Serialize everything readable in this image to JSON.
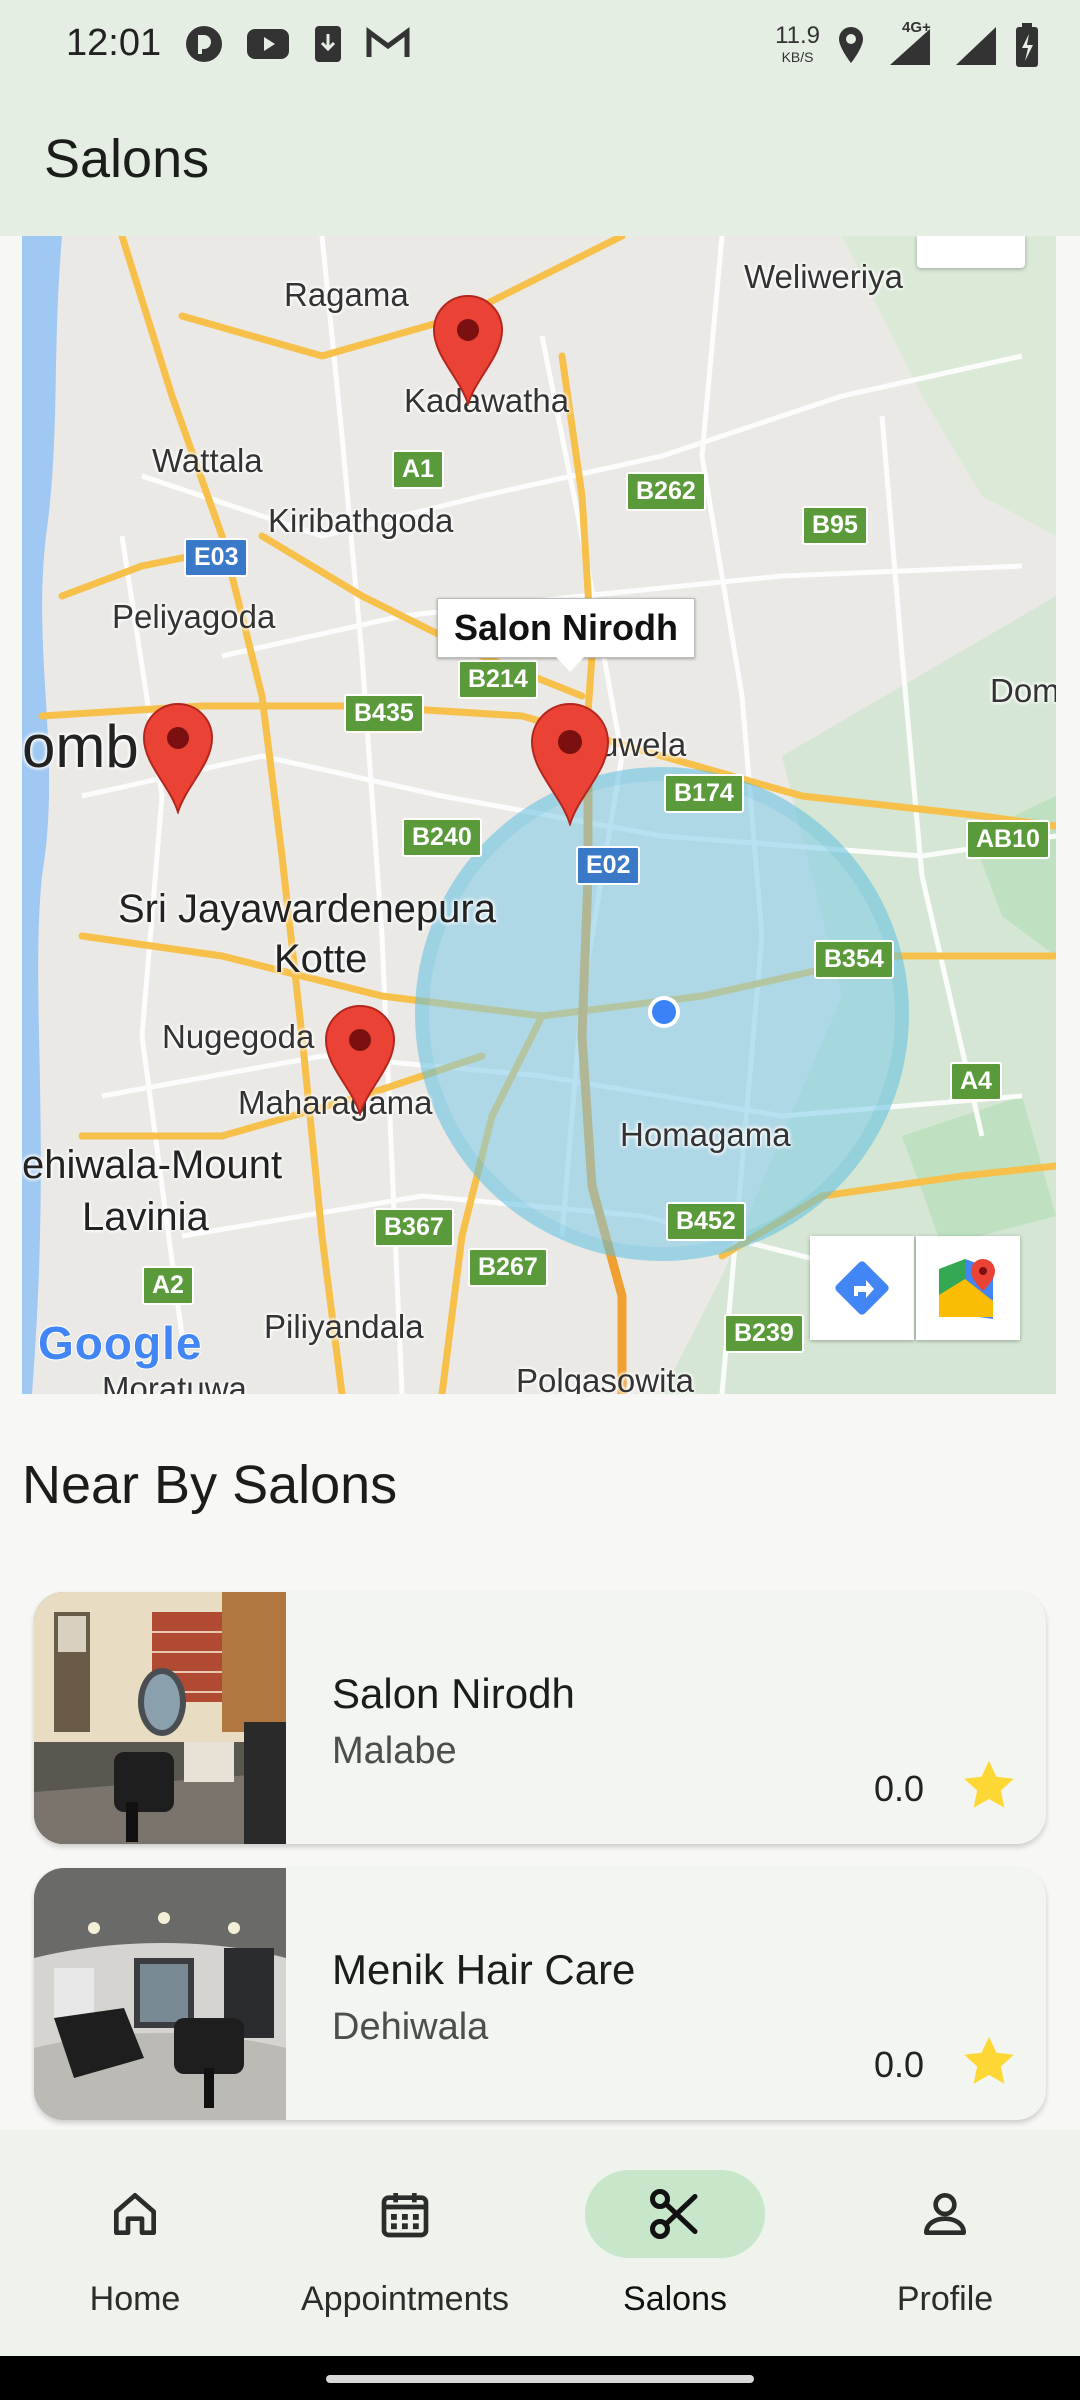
{
  "status_bar": {
    "time": "12:01",
    "net_speed_value": "11.9",
    "net_speed_unit": "KB/S",
    "network_type": "4G+",
    "icons": [
      "app-notification-icon",
      "youtube-icon",
      "download-icon",
      "gmail-icon",
      "location-icon",
      "signal-icon",
      "battery-charging-icon"
    ]
  },
  "app_bar": {
    "title": "Salons"
  },
  "map": {
    "places": {
      "ragama": "Ragama",
      "weliweriya": "Weliweriya",
      "kadawatha": "Kadawatha",
      "wattala": "Wattala",
      "kiribathgoda": "Kiribathgoda",
      "peliyagoda": "Peliyagoda",
      "colombo": "omb",
      "sri_jayawardenepura": "Sri Jayawardenepura",
      "kotte": "Kotte",
      "nugegoda": "Nugegoda",
      "maharagama": "Maharagama",
      "kaduwela": "uwela",
      "homagama": "Homagama",
      "dehiwala": "ehiwala-Mount",
      "lavinia": "Lavinia",
      "piliyandala": "Piliyandala",
      "polgasowita": "Polgasowita",
      "moratuwa": "Moratuwa",
      "dom": "Dom"
    },
    "route_shields": [
      "A1",
      "B262",
      "B95",
      "E03",
      "B214",
      "B435",
      "B174",
      "B240",
      "E02",
      "AB10",
      "B354",
      "A4",
      "B367",
      "B452",
      "B267",
      "B239",
      "A2"
    ],
    "callout": "Salon Nirodh",
    "google_logo": "Google",
    "buttons": {
      "directions": "directions-icon",
      "open_maps": "google-maps-icon"
    }
  },
  "nearby": {
    "title": "Near By Salons",
    "salons": [
      {
        "name": "Salon Nirodh",
        "location": "Malabe",
        "rating": "0.0"
      },
      {
        "name": "Menik Hair Care",
        "location": "Dehiwala",
        "rating": "0.0"
      }
    ]
  },
  "bottom_nav": {
    "items": [
      {
        "label": "Home",
        "icon": "home-icon",
        "active": false
      },
      {
        "label": "Appointments",
        "icon": "calendar-icon",
        "active": false
      },
      {
        "label": "Salons",
        "icon": "scissors-icon",
        "active": true
      },
      {
        "label": "Profile",
        "icon": "person-icon",
        "active": false
      }
    ]
  },
  "colors": {
    "app_bar_bg": "#e4eee2",
    "accent_pill": "#c8e6c9",
    "marker_red": "#ea4335",
    "radius_fill": "#7fcbe8",
    "star": "#fdd835"
  }
}
